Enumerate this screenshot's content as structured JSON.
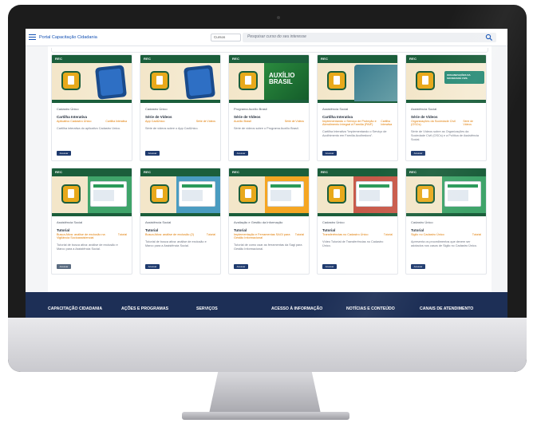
{
  "app": {
    "title": "Portal Capacitação Cidadania"
  },
  "search": {
    "filter_value": "Cursos",
    "placeholder": "Pesquisar curso do seu interesse"
  },
  "cards": [
    {
      "tag": "REC",
      "category": "Cadastro Único",
      "type": "Cartilha Interativa",
      "subtitle": "Aplicativo Cadastro Único",
      "badge": "Cartilha Interativa",
      "desc": "Cartilha interativa do aplicativo Cadastro Único.",
      "button": "Acessar",
      "art": "phone"
    },
    {
      "tag": "REC",
      "category": "Cadastro Único",
      "type": "Série de Vídeos",
      "subtitle": "App CadÚnico",
      "badge": "Série de Vídeos",
      "desc": "Série de vídeos sobre o App CadÚnico.",
      "button": "Acessar",
      "art": "phone"
    },
    {
      "tag": "REC",
      "category": "Programa Auxílio Brasil",
      "type": "Série de Vídeos",
      "subtitle": "Auxílio Brasil",
      "badge": "Série de Vídeos",
      "desc": "Série de vídeos sobre o Programa Auxílio Brasil.",
      "button": "Acessar",
      "art": "auxilio",
      "art_text": "AUXÍLIO BRASIL"
    },
    {
      "tag": "REC",
      "category": "Assistência Social",
      "type": "Cartilha Interativa",
      "subtitle": "Implementando o Serviço de Proteção e Atendimento Integral à Família (PAIF)",
      "badge": "Cartilha Interativa",
      "desc": "Cartilha Interativa \"Implementando o Serviço de Acolhimento em Família Acolhedora\".",
      "button": "Acessar",
      "art": "people"
    },
    {
      "tag": "REC",
      "category": "Assistência Social",
      "type": "Série de Vídeos",
      "subtitle": "Organizações da Sociedade Civil (OSCs)",
      "badge": "Série de Vídeos",
      "desc": "Série de Vídeos sobre as Organizações da Sociedade Civil (OSCs) e a Política de Assistência Social.",
      "button": "Acessar",
      "art": "banner",
      "art_text": "ORGANIZAÇÕES DA SOCIEDADE CIVIL"
    },
    {
      "tag": "REC",
      "category": "Assistência Social",
      "type": "Tutorial",
      "subtitle": "Busca Ativa: análise de exclusão na Vigilância Socioassistencial",
      "badge": "Tutorial",
      "desc": "Tutorial de busca ativa: análise de exclusão e Marco para a Assistência Social.",
      "button": "Acessar",
      "art": "screen-green"
    },
    {
      "tag": "REC",
      "category": "Assistência Social",
      "type": "Tutorial",
      "subtitle": "Busca Ativa: análise de exclusão (2)",
      "badge": "Tutorial",
      "desc": "Tutorial de busca ativa: análise de exclusão e Marco para a Assistência Social.",
      "button": "Acessar",
      "art": "screen-blue"
    },
    {
      "tag": "REC",
      "category": "Avaliação e Gestão da Informação",
      "type": "Tutorial",
      "subtitle": "Implementação e Ferramentas SAGI para Gestão Informacional",
      "badge": "Tutorial",
      "desc": "Tutorial de como usar as ferramentas da Sagi para Gestão Informacional.",
      "button": "Acessar",
      "art": "screen-orange"
    },
    {
      "tag": "REC",
      "category": "Cadastro Único",
      "type": "Tutorial",
      "subtitle": "Transferências no Cadastro Único",
      "badge": "Tutorial",
      "desc": "Vídeo Tutorial de Transferências no Cadastro Único.",
      "button": "Acessar",
      "art": "screen-red"
    },
    {
      "tag": "REC",
      "category": "Cadastro Único",
      "type": "Tutorial",
      "subtitle": "Sigilo no Cadastro Único",
      "badge": "Tutorial",
      "desc": "Apresenta os procedimentos que devem ser adotados nos casos de Sigilo no Cadastro Único.",
      "button": "Acessar",
      "art": "screen-green2"
    }
  ],
  "footer": {
    "items": [
      "CAPACITAÇÃO CIDADANIA",
      "AÇÕES E PROGRAMAS",
      "SERVIÇOS",
      "ACESSO À INFORMAÇÃO",
      "NOTÍCIAS E CONTEÚDO",
      "CANAIS DE ATENDIMENTO"
    ]
  },
  "colors": {
    "brand_blue": "#1351b4",
    "footer_navy": "#1d2f56",
    "accent_orange": "#e07b00",
    "rec_green": "#1b5e3b"
  }
}
